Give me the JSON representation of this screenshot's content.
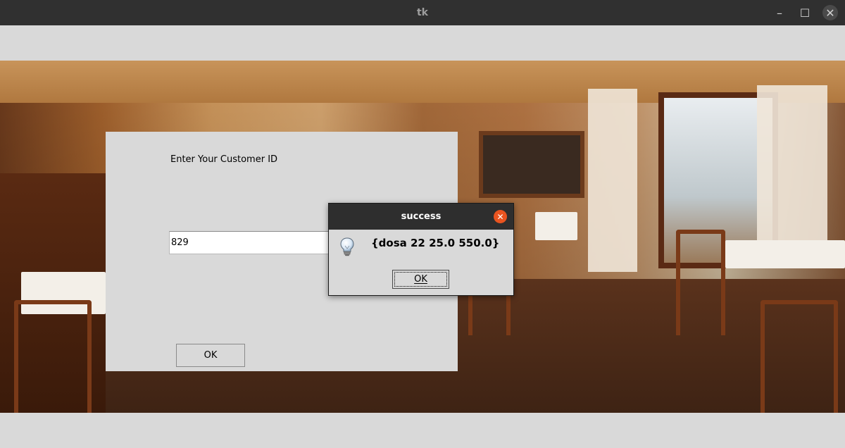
{
  "window": {
    "title": "tk",
    "controls": {
      "minimize": "–",
      "maximize": "☐",
      "close": "✕"
    }
  },
  "form": {
    "prompt_label": "Enter Your Customer ID",
    "customer_id_value": "829",
    "ok_label": "OK"
  },
  "dialog": {
    "title": "success",
    "message": "{dosa 22 25.0 550.0}",
    "ok_label": "OK",
    "close_glyph": "✕",
    "icon": "lightbulb-icon"
  },
  "colors": {
    "dialog_close": "#e95420",
    "titlebar": "#303030",
    "surface": "#d9d9d9"
  }
}
